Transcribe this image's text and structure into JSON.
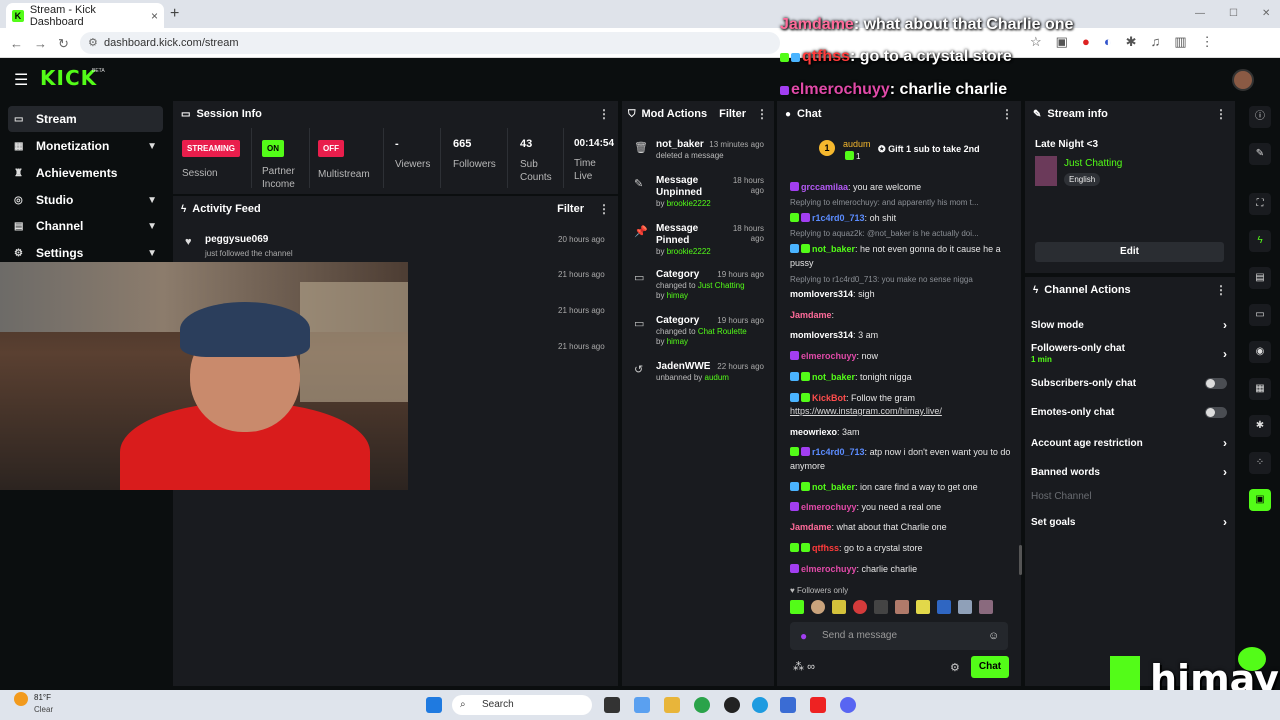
{
  "browser": {
    "tab_title": "Stream - Kick Dashboard",
    "url": "dashboard.kick.com/stream",
    "new_tab": "+",
    "close": "×"
  },
  "app": {
    "logo": "KICK",
    "beta": "BETA"
  },
  "sidebar": {
    "items": [
      {
        "label": "Stream"
      },
      {
        "label": "Monetization"
      },
      {
        "label": "Achievements"
      },
      {
        "label": "Studio"
      },
      {
        "label": "Channel"
      },
      {
        "label": "Settings"
      }
    ]
  },
  "session": {
    "title": "Session Info",
    "items": [
      {
        "badge": "STREAMING",
        "label": "Session"
      },
      {
        "badge": "ON",
        "label": "Partner Income"
      },
      {
        "badge": "OFF",
        "label": "Multistream"
      },
      {
        "value": "-",
        "label": "Viewers"
      },
      {
        "value": "665",
        "label": "Followers"
      },
      {
        "value": "43",
        "label": "Sub Counts"
      },
      {
        "value": "00:14:54",
        "label": "Time Live"
      }
    ]
  },
  "activity": {
    "title": "Activity Feed",
    "filter": "Filter",
    "rows": [
      {
        "user": "peggysue069",
        "text": "just followed the channel",
        "time": "20 hours ago"
      },
      {
        "time": "21 hours ago"
      },
      {
        "time": "21 hours ago"
      },
      {
        "time": "21 hours ago"
      }
    ]
  },
  "mod": {
    "title": "Mod Actions",
    "filter": "Filter",
    "rows": [
      {
        "title": "not_baker",
        "sub": "deleted a message",
        "time": "13 minutes ago"
      },
      {
        "title": "Message Unpinned",
        "by": "brookie2222",
        "time": "18 hours ago"
      },
      {
        "title": "Message Pinned",
        "by": "brookie2222",
        "time": "18 hours ago"
      },
      {
        "title": "Category",
        "changed": "Just Chatting",
        "by": "himay",
        "time": "19 hours ago"
      },
      {
        "title": "Category",
        "changed": "Chat Roulette",
        "by": "himay",
        "time": "19 hours ago"
      },
      {
        "title": "JadenWWE",
        "sub": "unbanned by",
        "by": "audum",
        "time": "22 hours ago"
      }
    ],
    "by_prefix": "by",
    "changed_prefix": "changed to"
  },
  "chat": {
    "title": "Chat",
    "pinned_user": "audum",
    "pinned_count": "1",
    "gift": "Gift 1 sub to take 2nd",
    "messages": [
      {
        "user": "grccamilaa",
        "text": "you are welcome",
        "color": "#b45af5"
      },
      {
        "reply": "Replying to elmerochuyy: and apparently his mom t..."
      },
      {
        "user": "r1c4rd0_713",
        "text": "oh shit",
        "color": "#5b8cff"
      },
      {
        "reply": "Replying to aquaz2k: @not_baker is he actually doi..."
      },
      {
        "user": "not_baker",
        "text": "he not even gonna do it cause he a pussy",
        "color": "#53fc18"
      },
      {
        "reply": "Replying to r1c4rd0_713: you make no sense nigga"
      },
      {
        "user": "momlovers314",
        "text": "sigh",
        "color": "#ffffff"
      },
      {
        "user": "Jamdame",
        "text": "",
        "color": "#ff6b9a"
      },
      {
        "user": "momlovers314",
        "text": "3 am",
        "color": "#ffffff"
      },
      {
        "user": "elmerochuyy",
        "text": "now",
        "color": "#e04aa8"
      },
      {
        "user": "not_baker",
        "text": "tonight nigga",
        "color": "#53fc18"
      },
      {
        "user": "KickBot",
        "text": "Follow the gram",
        "color": "#ff4d4d"
      },
      {
        "link": "https://www.instagram.com/himay.live/"
      },
      {
        "user": "meowriexo",
        "text": "3am",
        "color": "#ffffff"
      },
      {
        "user": "r1c4rd0_713",
        "text": "atp now i don't even want you to do anymore",
        "color": "#5b8cff"
      },
      {
        "user": "not_baker",
        "text": "ion care find a way to get one",
        "color": "#53fc18"
      },
      {
        "user": "elmerochuyy",
        "text": "you need a real one",
        "color": "#e04aa8"
      },
      {
        "user": "Jamdame",
        "text": "what about that Charlie one",
        "color": "#ff6b9a"
      },
      {
        "user": "qtfhss",
        "text": "go to a crystal store",
        "color": "#ff3b3b"
      },
      {
        "user": "elmerochuyy",
        "text": "charlie charlie",
        "color": "#e04aa8"
      }
    ],
    "followers_only": "Followers only",
    "placeholder": "Send a message",
    "send": "Chat",
    "infinity": "∞"
  },
  "stream_info": {
    "title": "Stream info",
    "stream_title": "Late Night <3",
    "category": "Just Chatting",
    "tag": "English",
    "edit": "Edit"
  },
  "channel_actions": {
    "title": "Channel Actions",
    "rows": [
      {
        "label": "Slow mode",
        "kind": "chevron"
      },
      {
        "label": "Followers-only chat",
        "sub": "1 min",
        "kind": "chevron"
      },
      {
        "label": "Subscribers-only chat",
        "kind": "toggle"
      },
      {
        "label": "Emotes-only chat",
        "kind": "toggle"
      },
      {
        "label": "Account age restriction",
        "kind": "chevron"
      },
      {
        "label": "Banned words",
        "kind": "chevron"
      },
      {
        "label": "Host Channel",
        "kind": "disabled"
      },
      {
        "label": "Set goals",
        "kind": "chevron"
      }
    ]
  },
  "overlay": {
    "lines": [
      {
        "user": "Jamdame",
        "text": "what about that Charlie one",
        "color": "#ff6b9a"
      },
      {
        "user": "qtfhss",
        "text": "go to a crystal store",
        "color": "#ff3b3b"
      },
      {
        "user": "elmerochuyy",
        "text": "charlie charlie",
        "color": "#e04aa8"
      }
    ],
    "watermark": "himay"
  },
  "taskbar": {
    "temp": "81°F",
    "weather": "Clear",
    "search": "Search"
  },
  "colors": {
    "accent": "#53fc18",
    "panel": "#191b1f",
    "bg": "#0b0e0f",
    "streaming": "#e91e4c"
  }
}
